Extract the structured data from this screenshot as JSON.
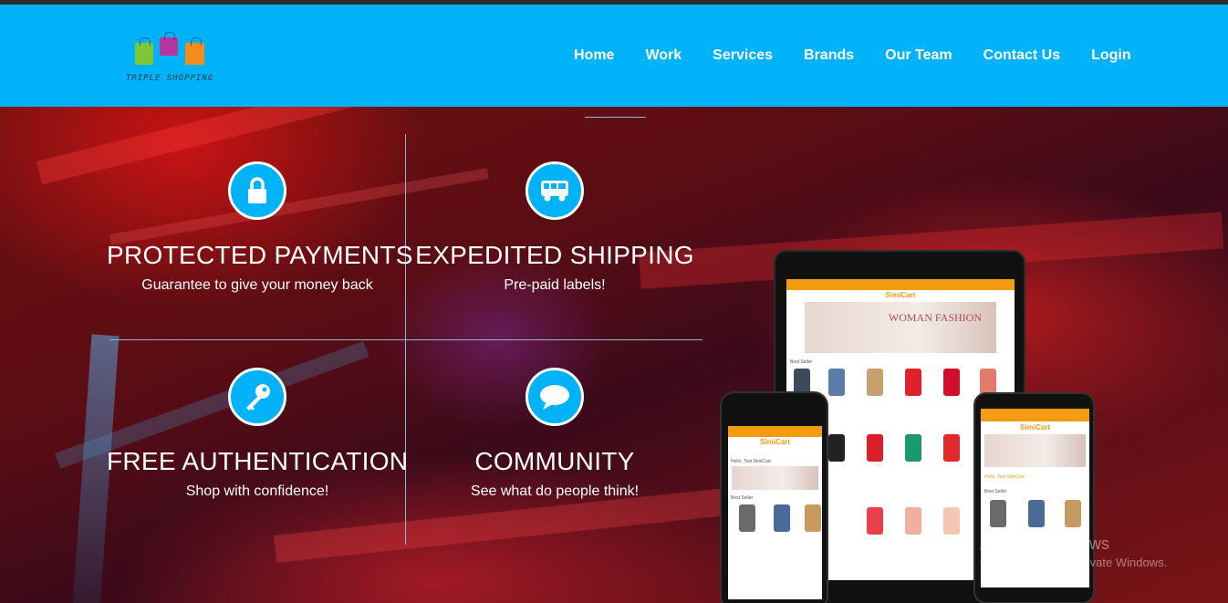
{
  "brand": {
    "logo_text": "TRIPLE SHOPPING"
  },
  "nav": {
    "items": [
      {
        "label": "Home"
      },
      {
        "label": "Work"
      },
      {
        "label": "Services"
      },
      {
        "label": "Brands"
      },
      {
        "label": "Our Team"
      },
      {
        "label": "Contact Us"
      },
      {
        "label": "Login"
      }
    ]
  },
  "features": [
    {
      "icon": "lock-icon",
      "title": "PROTECTED PAYMENTS",
      "subtitle": "Guarantee to give your money back"
    },
    {
      "icon": "truck-icon",
      "title": "EXPEDITED SHIPPING",
      "subtitle": "Pre-paid labels!"
    },
    {
      "icon": "key-icon",
      "title": "FREE AUTHENTICATION",
      "subtitle": "Shop with confidence!"
    },
    {
      "icon": "chat-bubble-icon",
      "title": "COMMUNITY",
      "subtitle": "See what do people think!"
    }
  ],
  "devices": {
    "app_name": "SimiCart",
    "banner_text": "WOMAN FASHION",
    "section_label": "Best Seller",
    "greeting": "Hello, Test SimiCart"
  },
  "watermark": {
    "line1": "Activate Windows",
    "line2": "Go to Settings to activate Windows."
  },
  "colors": {
    "accent": "#00b2f7",
    "app_orange": "#f39c12",
    "topstrip": "#2b2b2b"
  }
}
